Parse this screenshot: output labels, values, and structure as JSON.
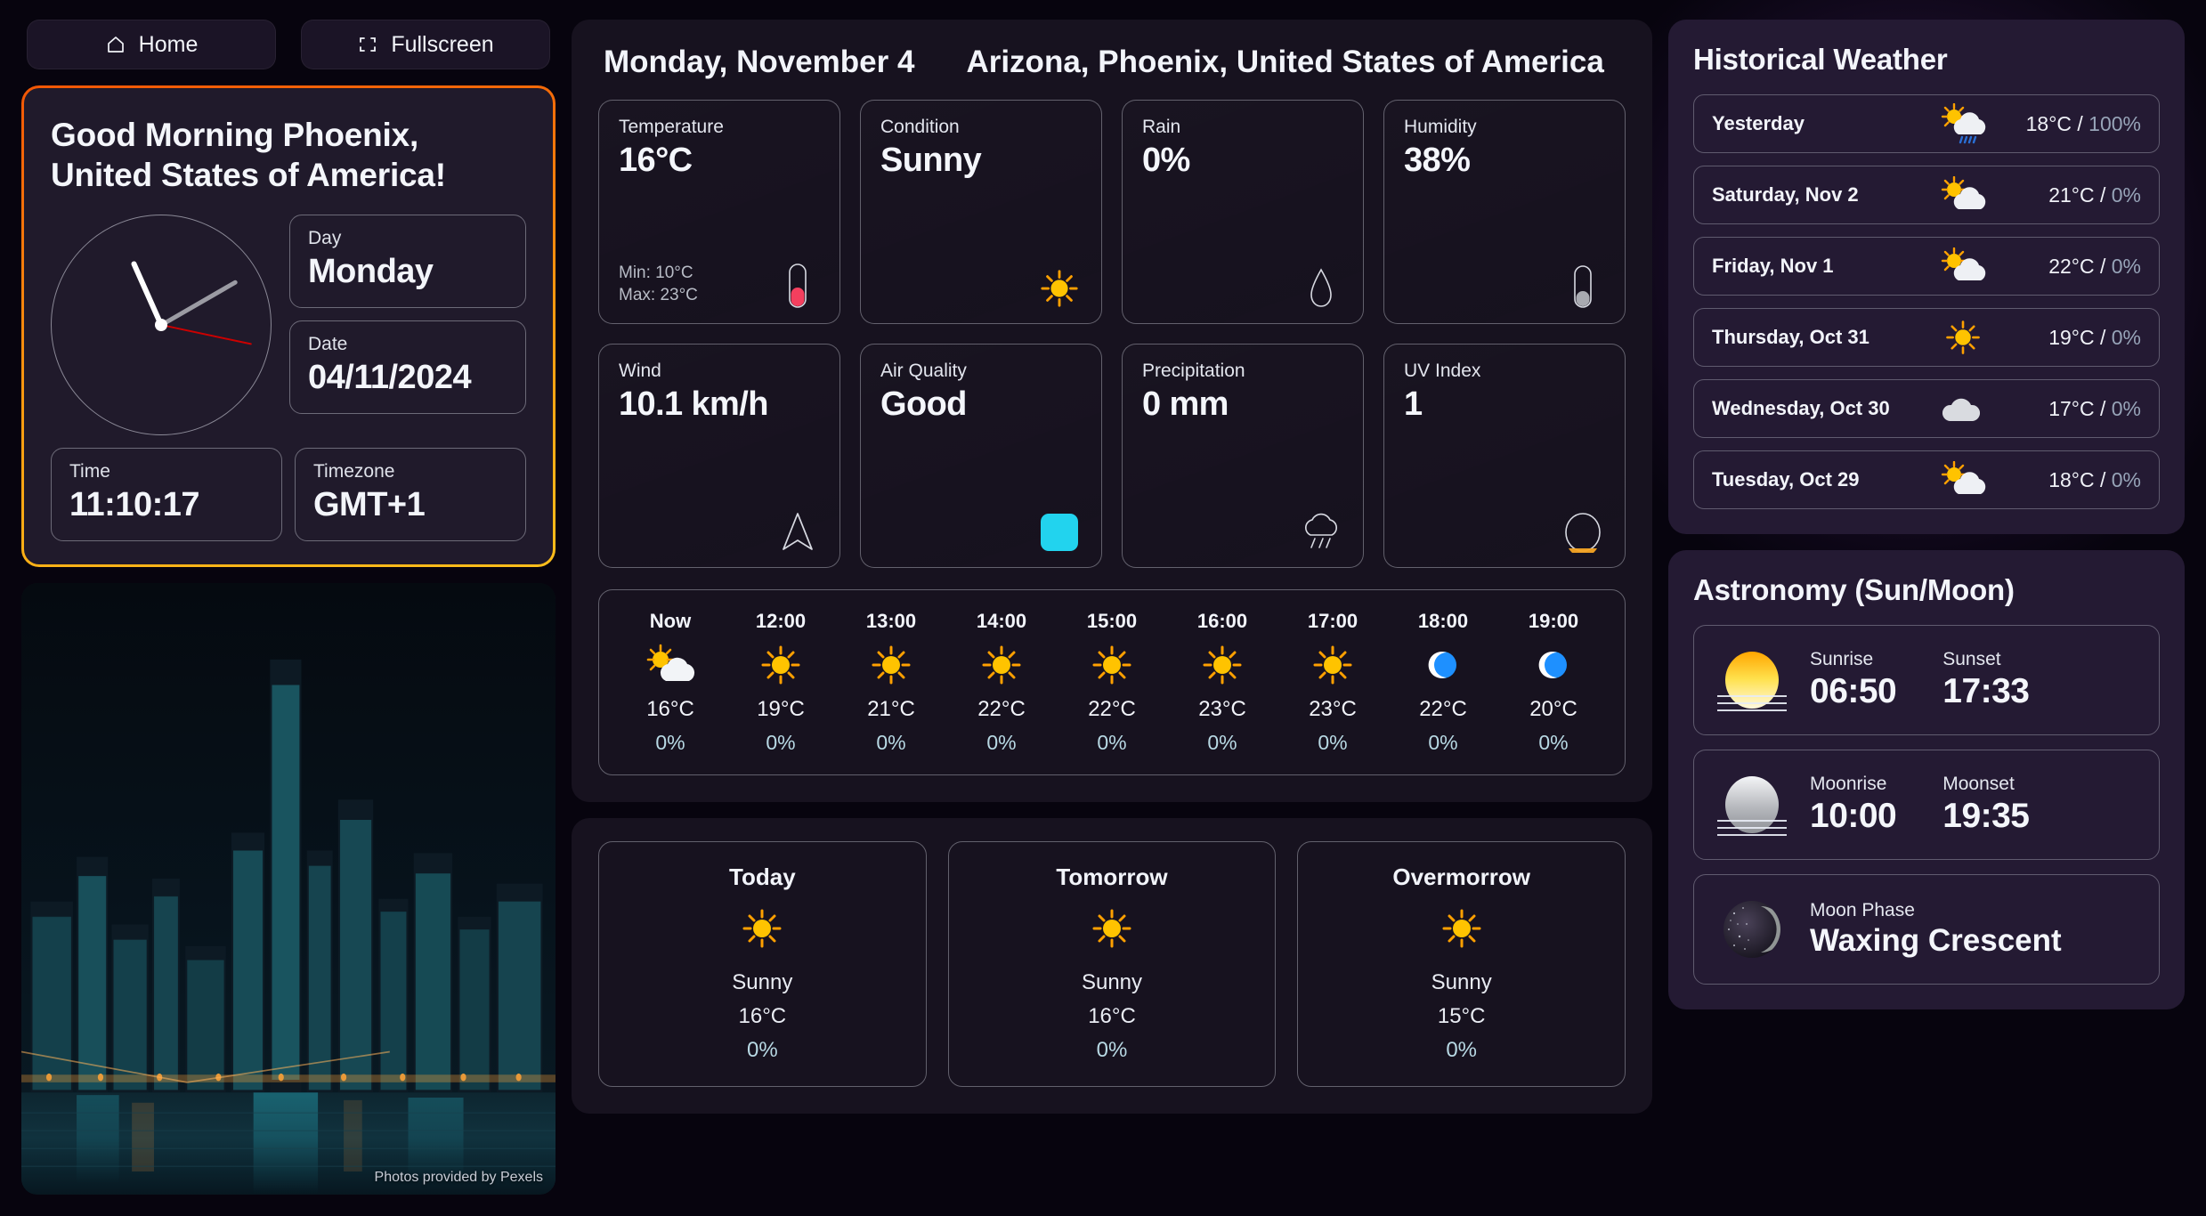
{
  "topbar": {
    "home_label": "Home",
    "fullscreen_label": "Fullscreen"
  },
  "greeting": {
    "title": "Good Morning Phoenix,\nUnited States of America!",
    "title_line1": "Good Morning Phoenix,",
    "title_line2": "United States of America!",
    "day_label": "Day",
    "day_value": "Monday",
    "date_label": "Date",
    "date_value": "04/11/2024",
    "time_label": "Time",
    "time_value": "11:10:17",
    "timezone_label": "Timezone",
    "timezone_value": "GMT+1"
  },
  "photo": {
    "credit": "Photos provided by Pexels"
  },
  "header": {
    "date": "Monday, November 4",
    "location": "Arizona, Phoenix, United States of America"
  },
  "metrics": [
    {
      "label": "Temperature",
      "value": "16°C",
      "sub_min": "Min: 10°C",
      "sub_max": "Max: 23°C",
      "icon": "thermometer-icon"
    },
    {
      "label": "Condition",
      "value": "Sunny",
      "icon": "sun-icon"
    },
    {
      "label": "Rain",
      "value": "0%",
      "icon": "droplet-icon"
    },
    {
      "label": "Humidity",
      "value": "38%",
      "icon": "humidity-gauge-icon"
    },
    {
      "label": "Wind",
      "value": "10.1 km/h",
      "icon": "navigation-arrow-icon"
    },
    {
      "label": "Air Quality",
      "value": "Good",
      "icon": "air-quality-square-icon"
    },
    {
      "label": "Precipitation",
      "value": "0 mm",
      "icon": "rain-cloud-icon"
    },
    {
      "label": "UV Index",
      "value": "1",
      "icon": "uv-gauge-icon"
    }
  ],
  "hourly": [
    {
      "time": "Now",
      "icon": "sun-behind-cloud-icon",
      "temp": "16°C",
      "pct": "0%"
    },
    {
      "time": "12:00",
      "icon": "sun-icon",
      "temp": "19°C",
      "pct": "0%"
    },
    {
      "time": "13:00",
      "icon": "sun-icon",
      "temp": "21°C",
      "pct": "0%"
    },
    {
      "time": "14:00",
      "icon": "sun-icon",
      "temp": "22°C",
      "pct": "0%"
    },
    {
      "time": "15:00",
      "icon": "sun-icon",
      "temp": "22°C",
      "pct": "0%"
    },
    {
      "time": "16:00",
      "icon": "sun-icon",
      "temp": "23°C",
      "pct": "0%"
    },
    {
      "time": "17:00",
      "icon": "sun-icon",
      "temp": "23°C",
      "pct": "0%"
    },
    {
      "time": "18:00",
      "icon": "crescent-moon-icon",
      "temp": "22°C",
      "pct": "0%"
    },
    {
      "time": "19:00",
      "icon": "crescent-moon-icon",
      "temp": "20°C",
      "pct": "0%"
    }
  ],
  "daily": [
    {
      "name": "Today",
      "icon": "sun-icon",
      "condition": "Sunny",
      "temp": "16°C",
      "pct": "0%"
    },
    {
      "name": "Tomorrow",
      "icon": "sun-icon",
      "condition": "Sunny",
      "temp": "16°C",
      "pct": "0%"
    },
    {
      "name": "Overmorrow",
      "icon": "sun-icon",
      "condition": "Sunny",
      "temp": "15°C",
      "pct": "0%"
    }
  ],
  "historical": {
    "title": "Historical Weather",
    "rows": [
      {
        "day": "Yesterday",
        "icon": "sun-behind-rain-cloud-icon",
        "temp": "18°C",
        "sep": " / ",
        "pct": "100%"
      },
      {
        "day": "Saturday, Nov 2",
        "icon": "sun-behind-cloud-icon",
        "temp": "21°C",
        "sep": " / ",
        "pct": "0%"
      },
      {
        "day": "Friday, Nov 1",
        "icon": "sun-behind-cloud-icon",
        "temp": "22°C",
        "sep": " / ",
        "pct": "0%"
      },
      {
        "day": "Thursday, Oct 31",
        "icon": "sun-icon",
        "temp": "19°C",
        "sep": " / ",
        "pct": "0%"
      },
      {
        "day": "Wednesday, Oct 30",
        "icon": "cloud-icon",
        "temp": "17°C",
        "sep": " / ",
        "pct": "0%"
      },
      {
        "day": "Tuesday, Oct 29",
        "icon": "sun-behind-cloud-icon",
        "temp": "18°C",
        "sep": " / ",
        "pct": "0%"
      }
    ]
  },
  "astronomy": {
    "title": "Astronomy (Sun/Moon)",
    "sun": {
      "icon": "sunrise-icon",
      "rise_label": "Sunrise",
      "rise_value": "06:50",
      "set_label": "Sunset",
      "set_value": "17:33"
    },
    "moon": {
      "icon": "moonrise-icon",
      "rise_label": "Moonrise",
      "rise_value": "10:00",
      "set_label": "Moonset",
      "set_value": "19:35"
    },
    "phase": {
      "icon": "moon-phase-icon",
      "label": "Moon Phase",
      "value": "Waxing Crescent"
    }
  },
  "colors": {
    "accent_start": "#f25605",
    "accent_end": "#fcbe1b",
    "sun_yellow": "#FFC300",
    "moon_blue": "#1e90ff",
    "air_quality": "#22d3ee",
    "uv_orange": "#f5a524",
    "temp_red": "#f43f5e",
    "pct_blue": "#b8d9e4"
  }
}
